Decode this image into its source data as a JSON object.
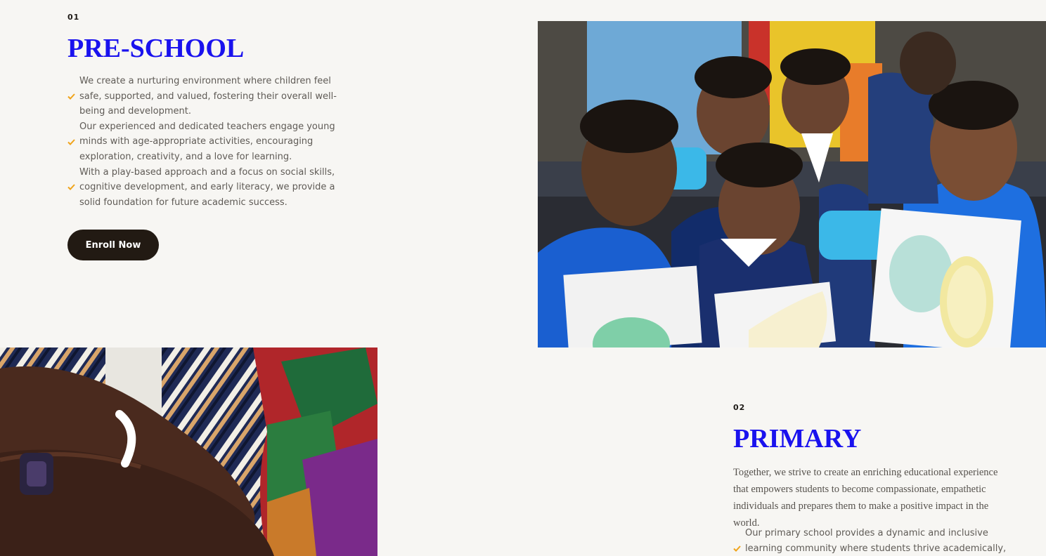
{
  "preschool": {
    "number": "01",
    "title": "PRE-SCHOOL",
    "points": [
      "We create a nurturing environment where children feel safe, supported, and valued, fostering their overall well-being and development.",
      "Our experienced and dedicated teachers engage young minds with age-appropriate activities, encouraging exploration, creativity, and a love for learning.",
      "With a play-based approach and a focus on social skills, cognitive development, and early literacy, we provide a solid foundation for future academic success."
    ],
    "cta_label": "Enroll Now",
    "photo_icon": "children-with-fruit-drawings-photo"
  },
  "primary": {
    "number": "02",
    "title": "PRIMARY",
    "intro": "Together, we strive to create an enriching educational experience that empowers students to become compassionate, empathetic individuals and prepares them to make a positive impact in the world.",
    "points": [
      "Our primary school provides a dynamic and inclusive learning community where students thrive academically, socially, and"
    ],
    "photo_icon": "crossed-arms-kente-cloth-photo"
  },
  "colors": {
    "background": "#f7f6f3",
    "title": "#1a12ee",
    "check": "#f0a41b",
    "button": "#221a13",
    "body_text": "#5f5b56"
  }
}
